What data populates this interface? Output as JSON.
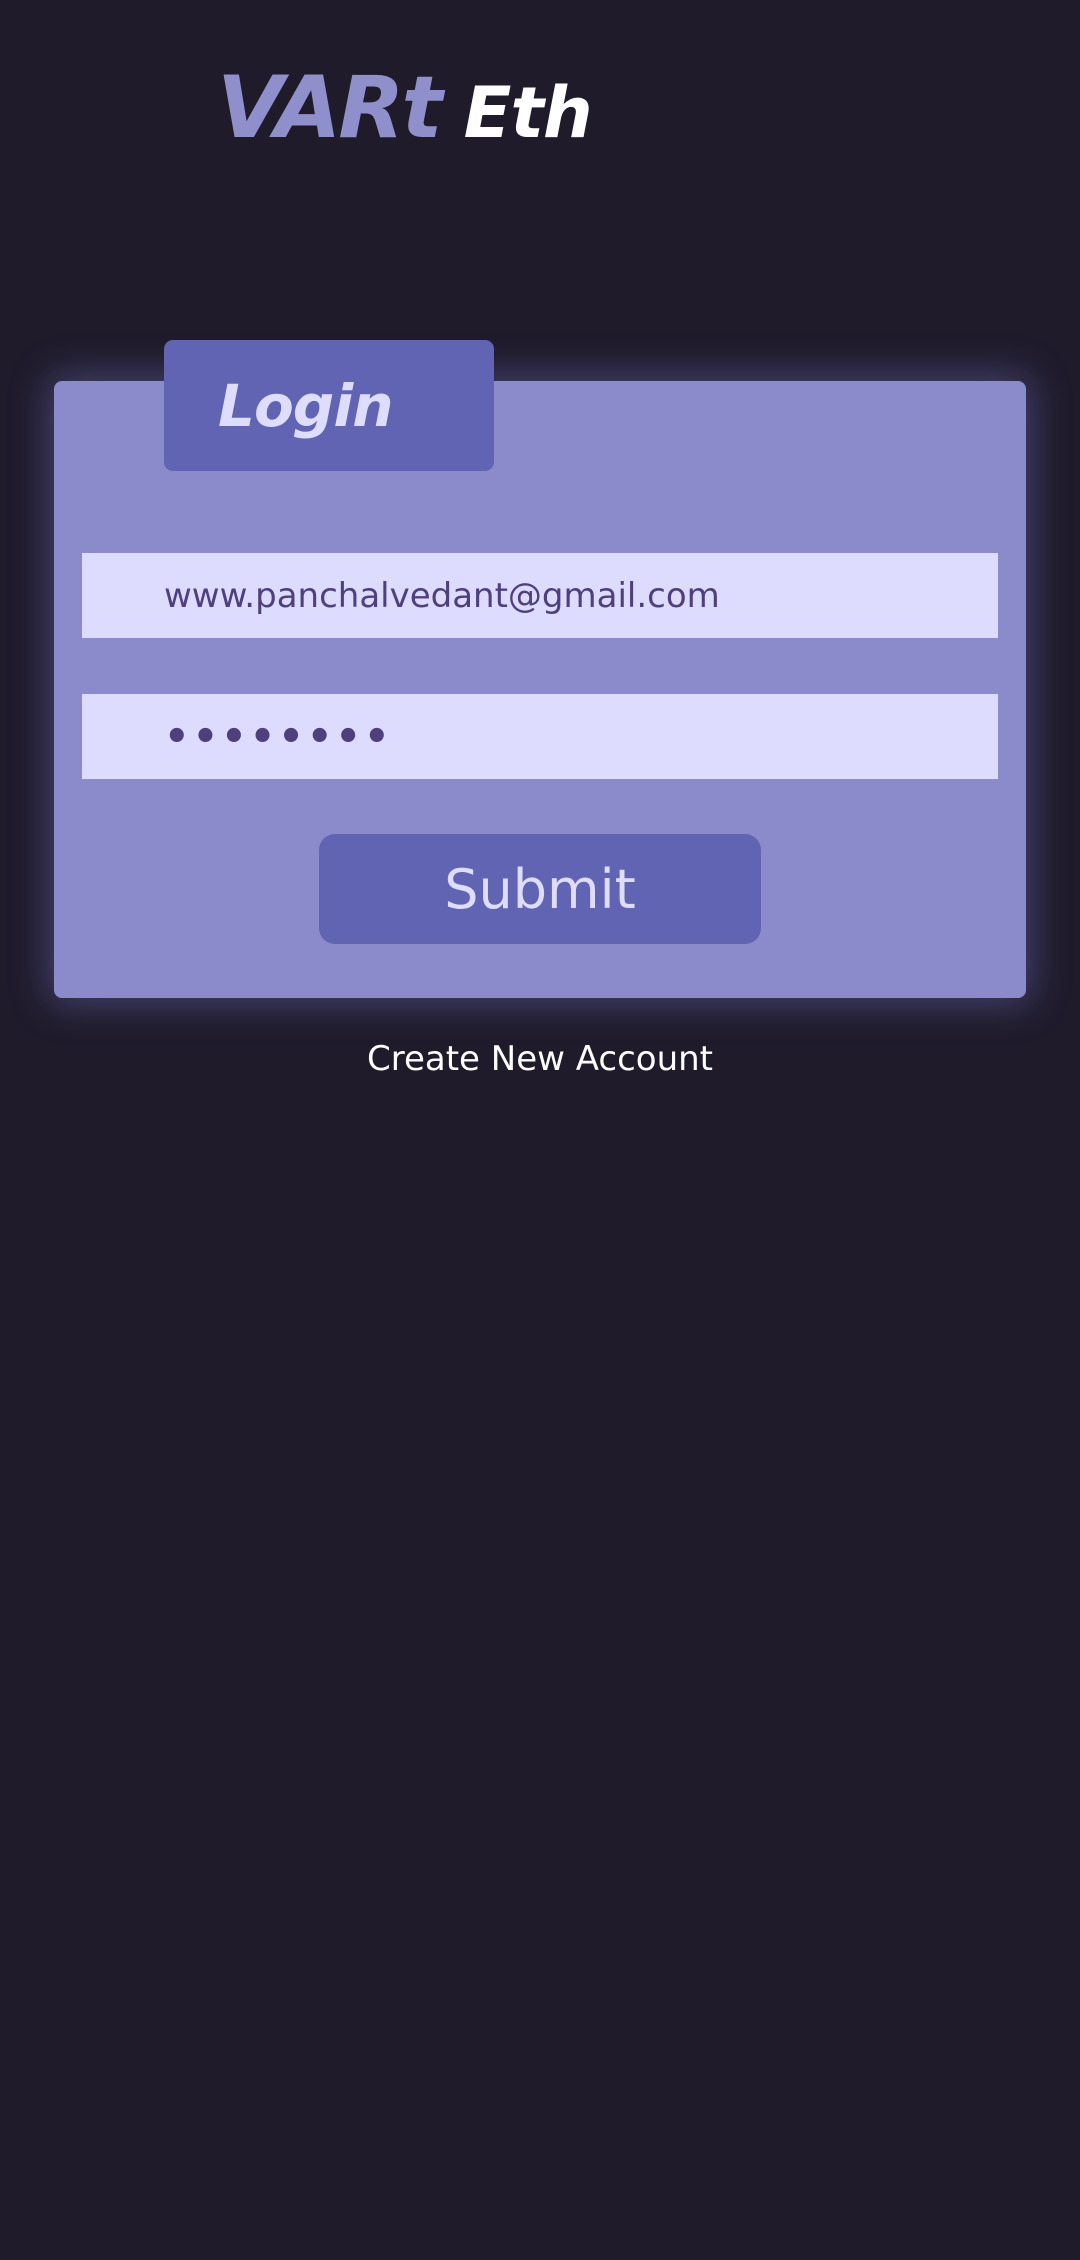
{
  "brand": {
    "name": "VARt",
    "suffix": "Eth"
  },
  "login": {
    "title": "Login",
    "email_value": "www.panchalvedant@gmail.com",
    "password_display": "••••••••",
    "submit_label": "Submit"
  },
  "links": {
    "create_account": "Create New Account"
  },
  "colors": {
    "background": "#1f1b2b",
    "card": "#8b8bcb",
    "accent": "#6163b3",
    "field": "#dddcff",
    "field_text": "#4f3f7c"
  }
}
